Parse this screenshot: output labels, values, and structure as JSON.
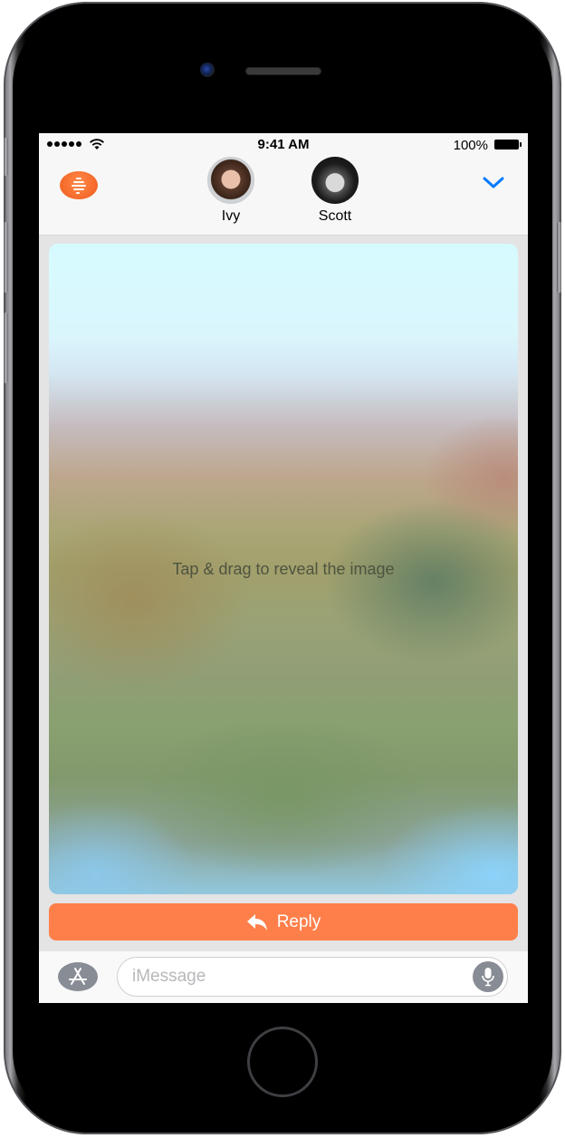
{
  "status_bar": {
    "time": "9:41 AM",
    "battery_percent": "100%",
    "signal_bars": 5,
    "icons": [
      "signal-dots-icon",
      "wifi-icon",
      "battery-icon"
    ]
  },
  "header": {
    "app_icon": "message-app-icon",
    "contacts": [
      {
        "name": "Ivy",
        "avatar": "avatar-ivy"
      },
      {
        "name": "Scott",
        "avatar": "avatar-scott"
      }
    ],
    "collapse_icon": "chevron-down-icon"
  },
  "message": {
    "hint": "Tap & drag to reveal the image"
  },
  "reply_button": {
    "label": "Reply",
    "icon": "reply-arrow-icon",
    "color": "#ff7f4a"
  },
  "input_bar": {
    "placeholder": "iMessage",
    "app_store_icon": "app-store-icon",
    "mic_icon": "microphone-icon"
  },
  "colors": {
    "accent_blue": "#007aff",
    "reply_orange": "#ff7f4a",
    "app_icon_orange": "#f26422"
  }
}
